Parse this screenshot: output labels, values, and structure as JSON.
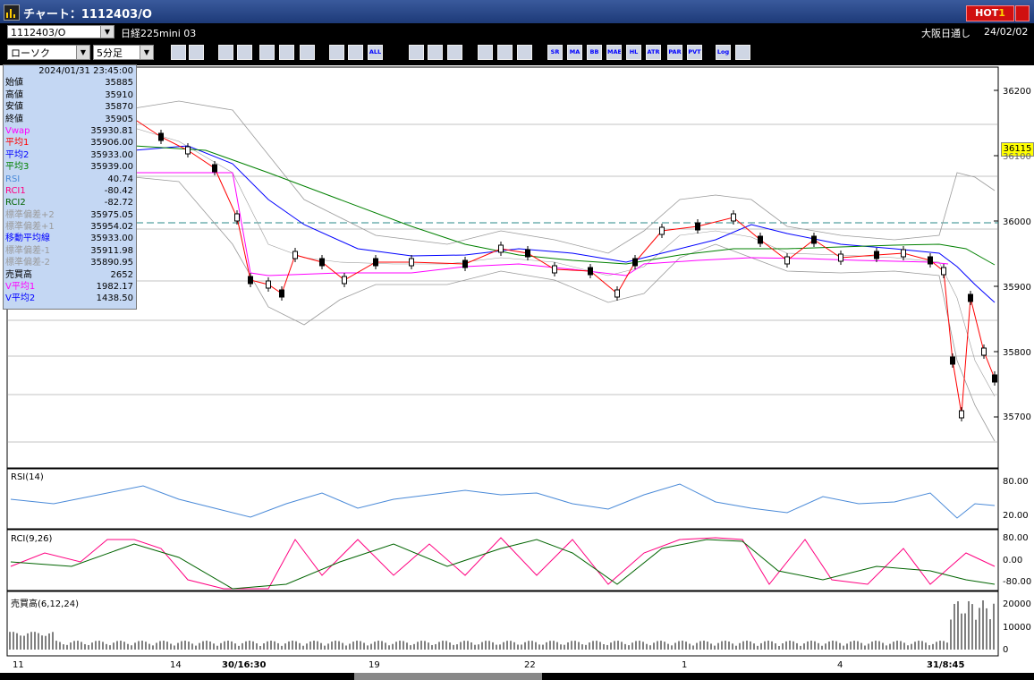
{
  "window": {
    "title": "チャート：1112403/O",
    "hot_label": "HOT",
    "hot_num": "1"
  },
  "controls": {
    "symbol_code": "1112403/O",
    "symbol_name": "日経225mini 03",
    "chart_type": "ローソク",
    "timeframe": "5分足",
    "market": "大阪日通し",
    "date": "24/02/02"
  },
  "toolbar": {
    "buttons": [
      "search",
      "crosshair",
      "bell",
      "grid",
      "scale-fit",
      "line-chart",
      "compare",
      "candle",
      "bar-ctrl",
      "all",
      "pen",
      "cursor",
      "back",
      "magnifier",
      "wrench",
      "palette",
      "SR",
      "MA",
      "BB",
      "MAE",
      "HL",
      "ATR",
      "PAR",
      "PVT",
      "Log",
      "exit"
    ],
    "text_labels": {
      "all": "ALL",
      "SR": "SR",
      "MA": "MA",
      "BB": "BB",
      "MAE": "MAE",
      "HL": "HL",
      "ATR": "ATR",
      "PAR": "PAR",
      "PVT": "PVT",
      "Log": "Log"
    }
  },
  "info": {
    "datetime": "2024/01/31  23:45:00",
    "rows": [
      {
        "label": "始値",
        "value": "35885",
        "color": "#000000"
      },
      {
        "label": "高値",
        "value": "35910",
        "color": "#000000"
      },
      {
        "label": "安値",
        "value": "35870",
        "color": "#000000"
      },
      {
        "label": "終値",
        "value": "35905",
        "color": "#000000"
      },
      {
        "label": "Vwap",
        "value": "35930.81",
        "color": "#ff00ff"
      },
      {
        "label": "平均1",
        "value": "35906.00",
        "color": "#ff0000"
      },
      {
        "label": "平均2",
        "value": "35933.00",
        "color": "#0000ff"
      },
      {
        "label": "平均3",
        "value": "35939.00",
        "color": "#008000"
      },
      {
        "label": "RSI",
        "value": "40.74",
        "color": "#4a8ad8"
      },
      {
        "label": "RCI1",
        "value": "-80.42",
        "color": "#ff0080"
      },
      {
        "label": "RCI2",
        "value": "-82.72",
        "color": "#006400"
      },
      {
        "label": "標準偏差+2",
        "value": "35975.05",
        "color": "#9a9a9a"
      },
      {
        "label": "標準偏差+1",
        "value": "35954.02",
        "color": "#9a9a9a"
      },
      {
        "label": "移動平均線",
        "value": "35933.00",
        "color": "#0000ff"
      },
      {
        "label": "標準偏差-1",
        "value": "35911.98",
        "color": "#9a9a9a"
      },
      {
        "label": "標準偏差-2",
        "value": "35890.95",
        "color": "#9a9a9a"
      },
      {
        "label": "売買高",
        "value": "2652",
        "color": "#000000"
      },
      {
        "label": "V平均1",
        "value": "1982.17",
        "color": "#ff00ff"
      },
      {
        "label": "V平均2",
        "value": "1438.50",
        "color": "#0000ff"
      }
    ]
  },
  "current_price": "36115",
  "price_axis": [
    "36200",
    "36100",
    "36000",
    "35900",
    "35800",
    "35700"
  ],
  "rsi_panel": {
    "label": "RSI(14)",
    "levels": [
      "80.00",
      "20.00"
    ]
  },
  "rci_panel": {
    "label": "RCI(9,26)",
    "levels": [
      "80.00",
      "0.00",
      "-80.00"
    ]
  },
  "vol_panel": {
    "label": "売買高(6,12,24)",
    "levels": [
      "20000",
      "10000",
      "0"
    ]
  },
  "x_axis": [
    "11",
    "14",
    "30/16:30",
    "19",
    "22",
    "1",
    "4",
    "31/8:45"
  ],
  "colors": {
    "up": "#ffffff",
    "down": "#000000",
    "bb": "#9a9a9a",
    "vwap": "#ff00ff",
    "ma1": "#ff0000",
    "ma2": "#0000ff",
    "ma3": "#008000",
    "rsi": "#4a8ad8",
    "rci1": "#ff0080",
    "rci2": "#006400",
    "vol": "#808080"
  }
}
